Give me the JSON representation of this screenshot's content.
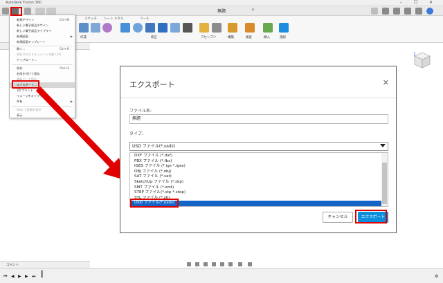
{
  "app": {
    "title": "Autodesk Fusion 360"
  },
  "document": {
    "tab_title": "無題"
  },
  "ribbon": {
    "groups": [
      "作成",
      "修正",
      "アセンブリ",
      "構築",
      "検査",
      "挿入",
      "選択"
    ],
    "sections": [
      "スケッチ",
      "シート メタル",
      "ツール"
    ]
  },
  "file_menu": {
    "items": [
      {
        "label": "新規デザイン",
        "shortcut": "Ctrl+N",
        "disabled": false
      },
      {
        "label": "新しい電子部品デザイン",
        "shortcut": "",
        "disabled": false
      },
      {
        "label": "新しい電子部品ライブラリ",
        "shortcut": "",
        "disabled": false
      },
      {
        "label": "新規図面",
        "shortcut": "",
        "disabled": false,
        "submenu": true
      },
      {
        "label": "新規図面テンプレート",
        "shortcut": "",
        "disabled": false
      },
      {
        "label": "開く...",
        "shortcut": "Ctrl+O",
        "disabled": false
      },
      {
        "label": "保存されたドキュメントを開く(0)",
        "shortcut": "",
        "disabled": true
      },
      {
        "label": "アップロード...",
        "shortcut": "",
        "disabled": false
      },
      {
        "label": "保存",
        "shortcut": "Ctrl+S",
        "disabled": false
      },
      {
        "label": "名前を付けて保存",
        "shortcut": "",
        "disabled": false
      },
      {
        "label": "最新として保存",
        "shortcut": "",
        "disabled": true
      },
      {
        "label": "エクスポート...",
        "shortcut": "",
        "disabled": false,
        "highlighted": true
      },
      {
        "label": "3D プリント",
        "shortcut": "",
        "disabled": false
      },
      {
        "label": "イメージをキャプチャ...",
        "shortcut": "",
        "disabled": false
      },
      {
        "label": "共有",
        "shortcut": "",
        "disabled": false,
        "submenu": true
      },
      {
        "label": "Web で詳細を表示",
        "shortcut": "",
        "disabled": true
      },
      {
        "label": "表示",
        "shortcut": "",
        "disabled": false
      }
    ]
  },
  "dialog": {
    "title": "エクスポート",
    "filename_label": "ファイル名:",
    "filename_value": "無題",
    "type_label": "タイプ:",
    "type_selected": "USD ファイル(*.usdz)",
    "type_options": [
      "DXF ファイル (*.dxf)",
      "FBX ファイル (*.fbx)",
      "IGES ファイル (*.igs *.iges)",
      "OBJ ファイル (*.obj)",
      "SAT ファイル (*.sat)",
      "SketchUp ファイル (*.skp)",
      "SMT ファイル (*.smt)",
      "STEP ファイル(*.stp *.step)",
      "STL ファイル (*.stl)",
      "USD ファイル(*.usdz)"
    ],
    "selected_index": 9,
    "cancel_label": "キャンセル",
    "export_label": "エクスポート"
  },
  "panels": {
    "comments": "コメント"
  },
  "colors": {
    "accent": "#0a8fdc",
    "highlight": "#e00000",
    "selection": "#1464c8"
  }
}
